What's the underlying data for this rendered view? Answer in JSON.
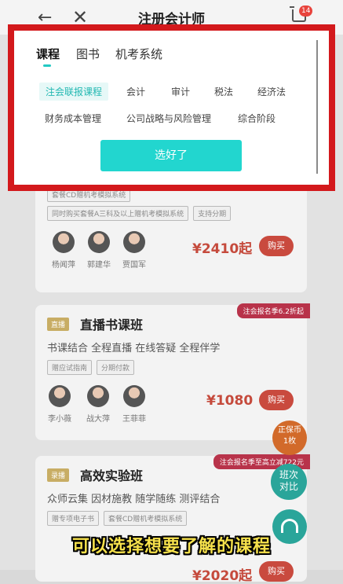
{
  "header": {
    "title": "注册会计师",
    "back_icon": "←",
    "close_icon": "✕",
    "cart_badge": "14"
  },
  "filter_panel": {
    "tabs": [
      {
        "label": "课程",
        "active": true
      },
      {
        "label": "图书",
        "active": false
      },
      {
        "label": "机考系统",
        "active": false
      }
    ],
    "subjects_row1": [
      "注会联报课程",
      "会计",
      "审计",
      "税法",
      "经济法"
    ],
    "subjects_row2": [
      "财务成本管理",
      "公司战略与风险管理",
      "综合阶段"
    ],
    "selected_subject": "注会联报课程",
    "confirm_label": "选好了",
    "accent_color": "#22d6cf"
  },
  "cards": [
    {
      "tags_top": [
        "套餐CD赠机考模拟系统"
      ],
      "tags": [
        "同时购买套餐A三科及以上赠机考模拟系统",
        "支持分期"
      ],
      "teachers": [
        "杨闻萍",
        "郭建华",
        "贾国军"
      ],
      "price": "¥2410起",
      "buy_label": "购买"
    },
    {
      "label": "直播",
      "title": "直播书课班",
      "subtitle": "书课结合 全程直播 在线答疑 全程伴学",
      "ribbon": "注会报名季6.2折起",
      "tags": [
        "赠应试指南",
        "分期付款"
      ],
      "teachers": [
        "李小薇",
        "战大萍",
        "王菲菲"
      ],
      "price": "¥1080",
      "buy_label": "购买"
    },
    {
      "label": "录播",
      "title": "高效实验班",
      "subtitle": "众师云集 因材施教 随学随练 测评结合",
      "ribbon": "注会报名季至高立减722元",
      "tags": [
        "赠专项电子书",
        "套餐CD赠机考模拟系统"
      ],
      "price": "¥2020起",
      "buy_label": "购买"
    }
  ],
  "float_buttons": {
    "coupon_line1": "正保币",
    "coupon_line2": "1枚",
    "compare_line1": "班次",
    "compare_line2": "对比",
    "service_icon": "headset-icon"
  },
  "caption": "可以选择想要了解的课程"
}
